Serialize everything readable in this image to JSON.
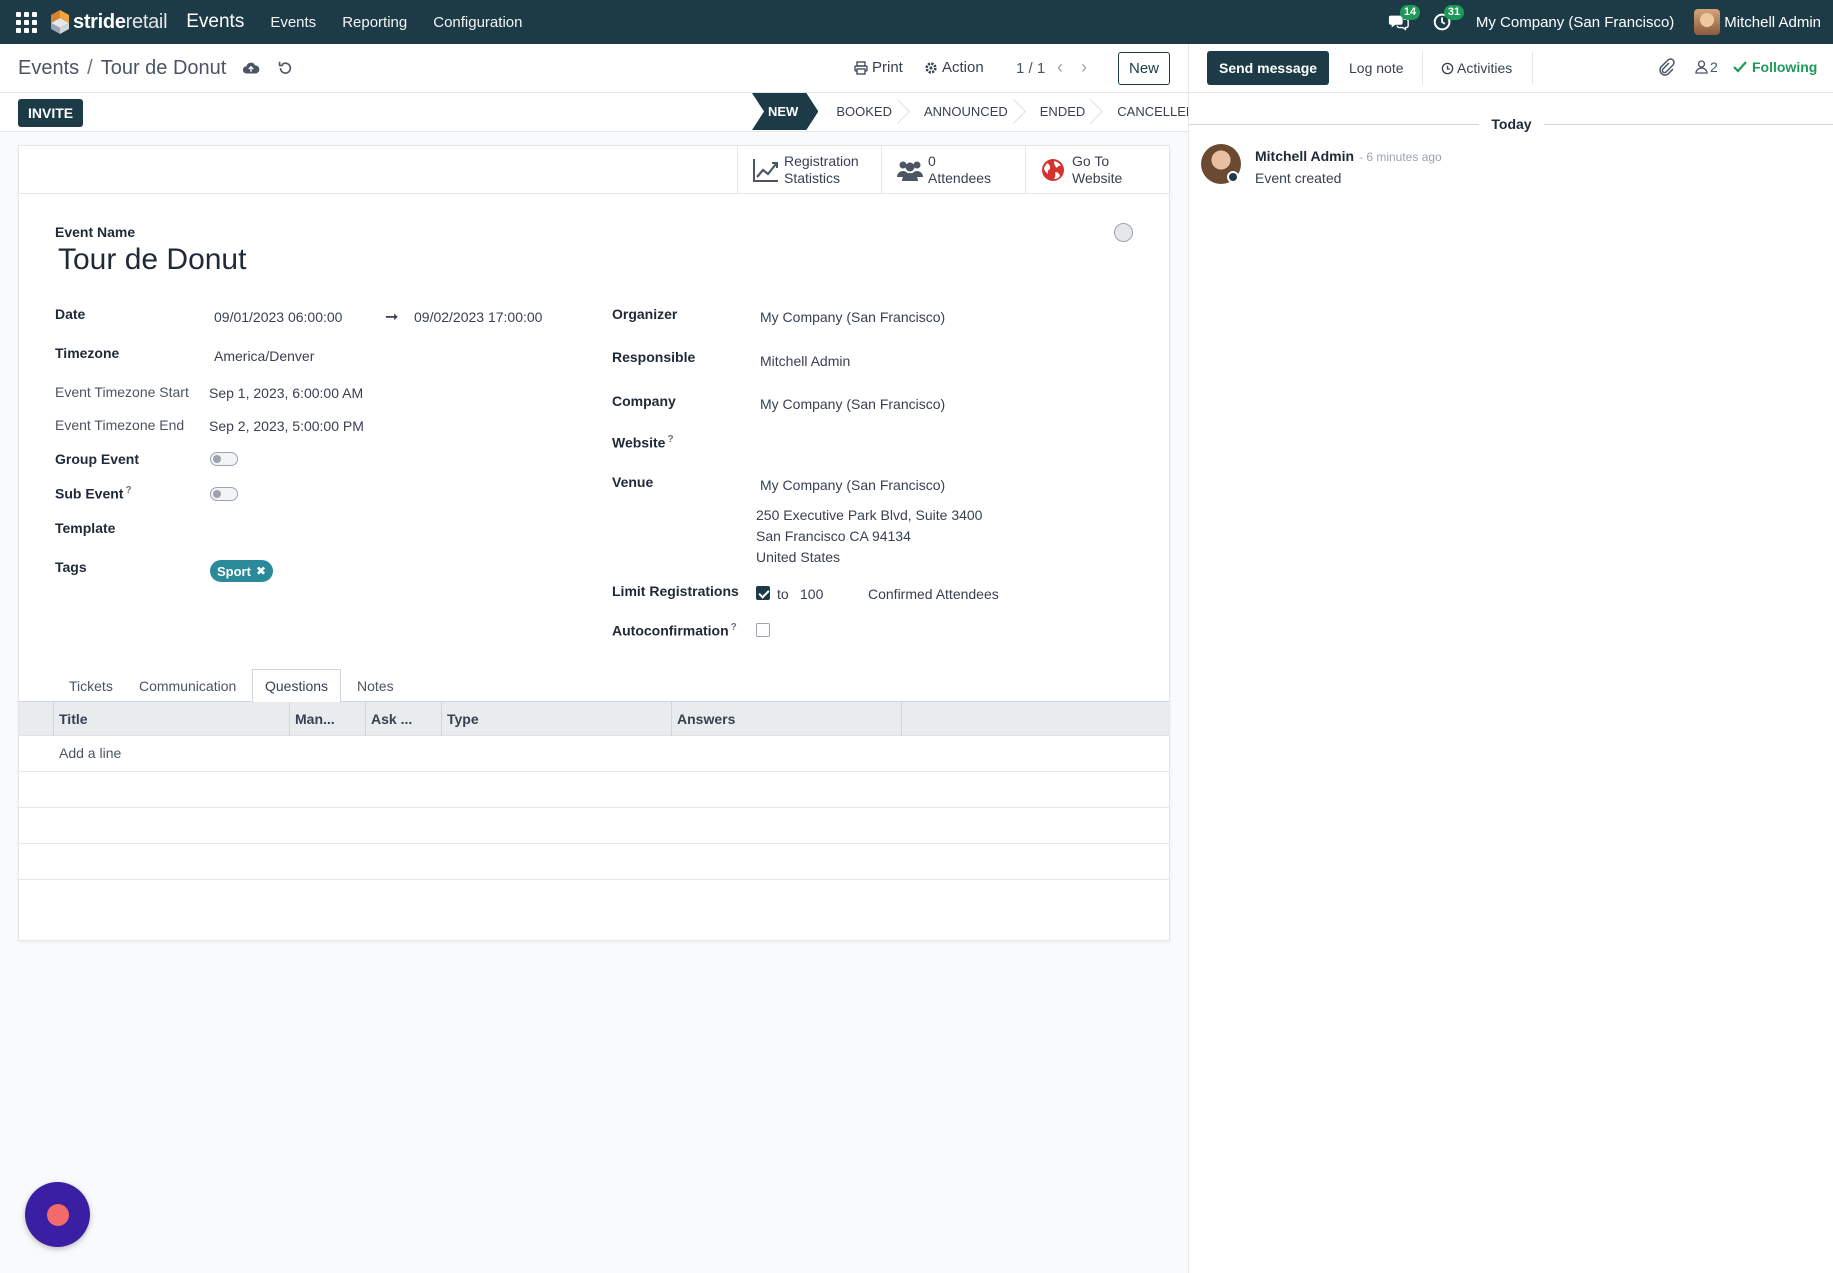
{
  "navbar": {
    "brand_bold": "stride",
    "brand_light": "retail",
    "app_title": "Events",
    "menu": [
      "Events",
      "Reporting",
      "Configuration"
    ],
    "messages_count": "14",
    "activities_count": "31",
    "company": "My Company (San Francisco)",
    "user": "Mitchell Admin"
  },
  "control": {
    "breadcrumb_parent": "Events",
    "breadcrumb_current": "Tour de Donut",
    "print_label": "Print",
    "action_label": "Action",
    "pager": "1 / 1",
    "new_label": "New"
  },
  "statusbar": {
    "invite_label": "INVITE",
    "stages": [
      "NEW",
      "BOOKED",
      "ANNOUNCED",
      "ENDED",
      "CANCELLED"
    ],
    "active_stage": "NEW"
  },
  "smart_buttons": {
    "registration": [
      "Registration",
      "Statistics"
    ],
    "attendees": [
      "0",
      "Attendees"
    ],
    "website": [
      "Go To",
      "Website"
    ]
  },
  "form": {
    "event_name_label": "Event Name",
    "event_name": "Tour de Donut",
    "date_label": "Date",
    "date_start": "09/01/2023 06:00:00",
    "date_end": "09/02/2023 17:00:00",
    "timezone_label": "Timezone",
    "timezone": "America/Denver",
    "tz_start_label": "Event Timezone Start",
    "tz_start": "Sep 1, 2023, 6:00:00 AM",
    "tz_end_label": "Event Timezone End",
    "tz_end": "Sep 2, 2023, 5:00:00 PM",
    "group_event_label": "Group Event",
    "sub_event_label": "Sub Event",
    "template_label": "Template",
    "tags_label": "Tags",
    "tag": "Sport",
    "organizer_label": "Organizer",
    "organizer": "My Company (San Francisco)",
    "responsible_label": "Responsible",
    "responsible": "Mitchell Admin",
    "company_label": "Company",
    "company": "My Company (San Francisco)",
    "website_label": "Website",
    "venue_label": "Venue",
    "venue": "My Company (San Francisco)",
    "venue_address": [
      "250 Executive Park Blvd, Suite 3400",
      "San Francisco CA 94134",
      "United States"
    ],
    "limit_label": "Limit Registrations",
    "limit_to": "to",
    "limit_value": "100",
    "limit_suffix": "Confirmed Attendees",
    "autoconfirm_label": "Autoconfirmation",
    "help_mark": "?"
  },
  "tabs": [
    "Tickets",
    "Communication",
    "Questions",
    "Notes"
  ],
  "active_tab": "Questions",
  "table": {
    "headers": [
      "Title",
      "Man...",
      "Ask ...",
      "Type",
      "Answers"
    ],
    "add_line": "Add a line"
  },
  "chatter": {
    "send_label": "Send message",
    "log_label": "Log note",
    "activities_label": "Activities",
    "followers_count": "2",
    "following_label": "Following",
    "today_label": "Today",
    "message": {
      "author": "Mitchell Admin",
      "time": "- 6 minutes ago",
      "body": "Event created"
    }
  },
  "colors": {
    "primary": "#1c3b47",
    "tag": "#2a8a99",
    "success": "#1d9a58"
  }
}
